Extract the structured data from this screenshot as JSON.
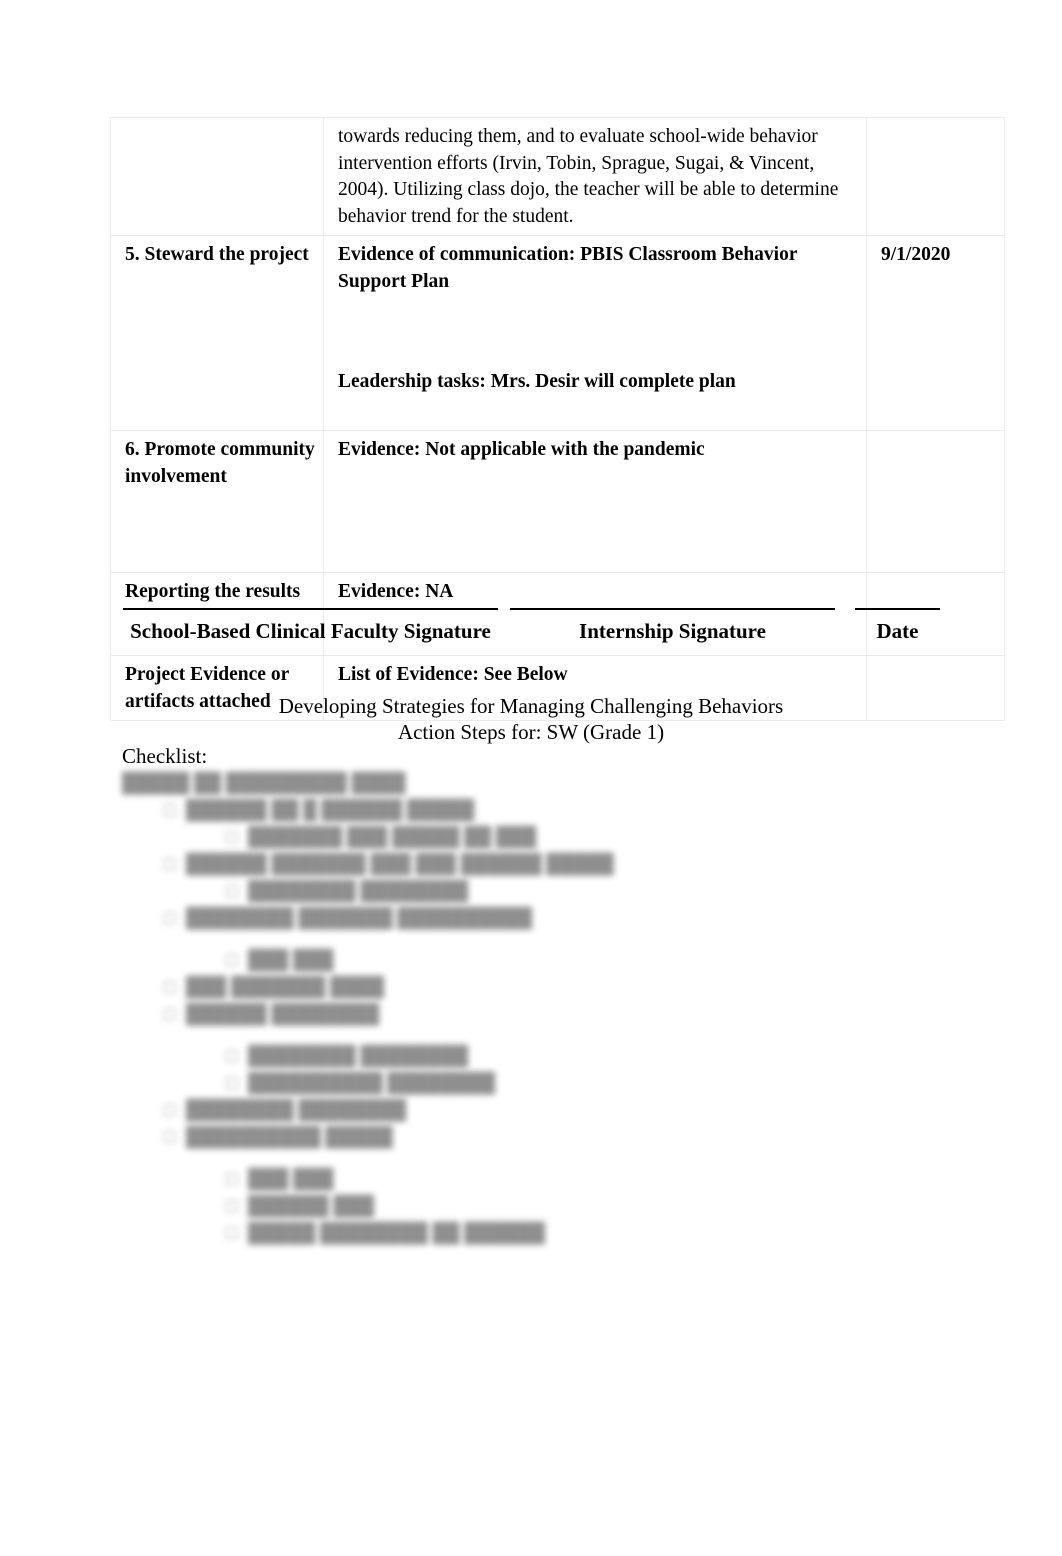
{
  "document": {
    "table": {
      "rows": [
        {
          "name": "continuation-row",
          "label": "",
          "evidence_lines": [
            "towards reducing them, and to evaluate school-wide behavior intervention efforts (Irvin, Tobin, Sprague, Sugai, & Vincent, 2004). Utilizing class dojo, the teacher will be able to determine behavior trend for the student."
          ],
          "evidence_bold": false,
          "date": ""
        },
        {
          "name": "steward-the-project-row",
          "label": "5. Steward the project",
          "evidence_lines": [
            "Evidence of communication: PBIS Classroom Behavior Support Plan",
            "Leadership tasks: Mrs. Desir will complete plan"
          ],
          "evidence_bold": true,
          "date": "9/1/2020"
        },
        {
          "name": "promote-community-involvement-row",
          "label": "6. Promote community involvement",
          "evidence_lines": [
            "Evidence: Not applicable with the pandemic"
          ],
          "evidence_bold": true,
          "date": ""
        },
        {
          "name": "reporting-the-results-row",
          "label": "Reporting the results",
          "evidence_lines": [
            "Evidence: NA"
          ],
          "evidence_bold": true,
          "date": ""
        },
        {
          "name": "project-evidence-row",
          "label": "Project Evidence or artifacts attached",
          "evidence_lines": [
            "List of Evidence: See Below"
          ],
          "evidence_bold": true,
          "date": ""
        }
      ]
    },
    "signatures": [
      {
        "name": "school-based-clinical-faculty-signature",
        "label": "School-Based Clinical Faculty Signature"
      },
      {
        "name": "internship-signature",
        "label": "Internship Signature"
      },
      {
        "name": "date-signature",
        "label": "Date"
      }
    ],
    "headings": {
      "line1": "Developing Strategies for Managing Challenging Behaviors",
      "line2": "Action Steps for: SW (Grade 1)"
    },
    "checklist_label": "Checklist:",
    "checklist_redacted": {
      "note": "content is visually blurred/redacted in the source image and is not legible",
      "lines": [
        {
          "level": 0,
          "bullet": "",
          "text": "█████ ██ █████████ ████"
        },
        {
          "level": 1,
          "bullet": "□",
          "text": "██████ ██ █ ██████ █████"
        },
        {
          "level": 2,
          "bullet": "□",
          "text": "███████ ███ █████ ██ ███"
        },
        {
          "level": 1,
          "bullet": "□",
          "text": "██████ ███████ ███ ███ ██████ █████"
        },
        {
          "level": 2,
          "bullet": "□",
          "text": "████████ ████████"
        },
        {
          "level": 1,
          "bullet": "□",
          "text": "████████ ███████ ██████████"
        },
        {
          "level": 2,
          "bullet": "□",
          "text": "███  ███"
        },
        {
          "level": 1,
          "bullet": "□",
          "text": "███ ███████ ████"
        },
        {
          "level": 1,
          "bullet": "□",
          "text": "██████ ████████"
        },
        {
          "level": 2,
          "bullet": "□",
          "text": "████████ ████████"
        },
        {
          "level": 2,
          "bullet": "□",
          "text": "██████████ ████████"
        },
        {
          "level": 1,
          "bullet": "□",
          "text": "████████ ████████"
        },
        {
          "level": 1,
          "bullet": "□",
          "text": "██████████ █████"
        },
        {
          "level": 2,
          "bullet": "□",
          "text": "███ ███"
        },
        {
          "level": 2,
          "bullet": "□",
          "text": "██████ ███"
        },
        {
          "level": 2,
          "bullet": "□",
          "text": "█████ ████████ ██ ██████"
        }
      ]
    }
  }
}
